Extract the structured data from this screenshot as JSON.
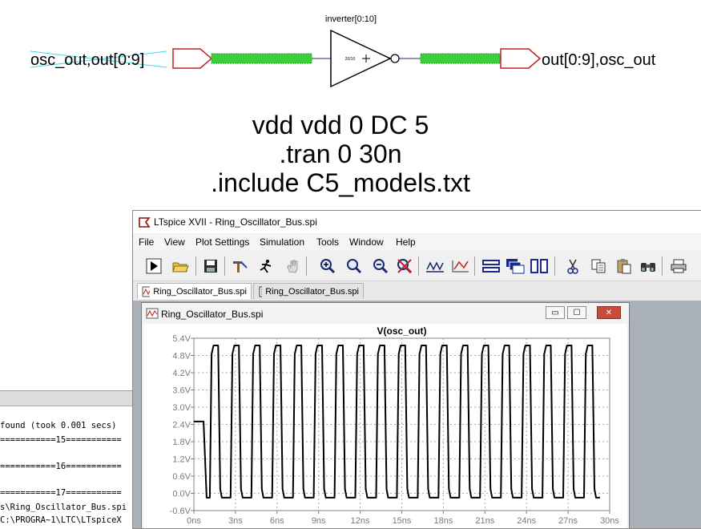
{
  "schematic": {
    "inst_label": "inverter[0:10]",
    "symbol_text": "20/10",
    "left_net": "osc_out,out[0:9]",
    "right_net": "out[0:9],osc_out",
    "spice": {
      "line1": "vdd vdd 0 DC 5",
      "line2": ".tran 0 30n",
      "line3": ".include C5_models.txt"
    }
  },
  "console": {
    "lines": [
      " found (took 0.001 secs)",
      "===========15===========",
      "===========16===========",
      "===========17===========",
      "s\\Ring_Oscillator_Bus.spi",
      "C:\\PROGRA~1\\LTC\\LTspiceX"
    ]
  },
  "ltspice": {
    "title": "LTspice XVII - Ring_Oscillator_Bus.spi",
    "menus": [
      "File",
      "View",
      "Plot Settings",
      "Simulation",
      "Tools",
      "Window",
      "Help"
    ],
    "tabs": [
      "Ring_Oscillator_Bus.spi",
      "Ring_Oscillator_Bus.spi"
    ],
    "plot_window_title": "Ring_Oscillator_Bus.spi",
    "window_buttons": {
      "minimize": "▭",
      "maximize": "☐",
      "close": "✕"
    }
  },
  "icons": [
    "app-logo-icon",
    "run-icon",
    "open-icon",
    "save-icon",
    "hammer-icon",
    "halt-icon",
    "pan-hand-icon",
    "zoom-in-icon",
    "zoom-full-icon",
    "zoom-out-icon",
    "cancel-zoom-icon",
    "autorange-icon",
    "plot-settings-icon",
    "tile-h-icon",
    "cascade-icon",
    "tile-v-icon",
    "cut-icon",
    "copy-icon",
    "paste-icon",
    "find-icon",
    "print-icon"
  ],
  "chart_data": {
    "type": "line",
    "title": "V(osc_out)",
    "xlabel": "",
    "ylabel": "",
    "xlim": [
      0,
      30
    ],
    "ylim": [
      -0.6,
      5.4
    ],
    "x_ticks": [
      "0ns",
      "3ns",
      "6ns",
      "9ns",
      "12ns",
      "15ns",
      "18ns",
      "21ns",
      "24ns",
      "27ns",
      "30ns"
    ],
    "y_ticks": [
      "5.4V",
      "4.8V",
      "4.2V",
      "3.6V",
      "3.0V",
      "2.4V",
      "1.8V",
      "1.2V",
      "0.6V",
      "0.0V",
      "-0.6V"
    ],
    "series": [
      {
        "name": "V(osc_out)",
        "color": "#000000",
        "initial_value": 2.5,
        "start_time": 0.8,
        "high": 5.15,
        "low": -0.15,
        "period": 1.5,
        "cycles": 19
      }
    ],
    "grid": true
  }
}
